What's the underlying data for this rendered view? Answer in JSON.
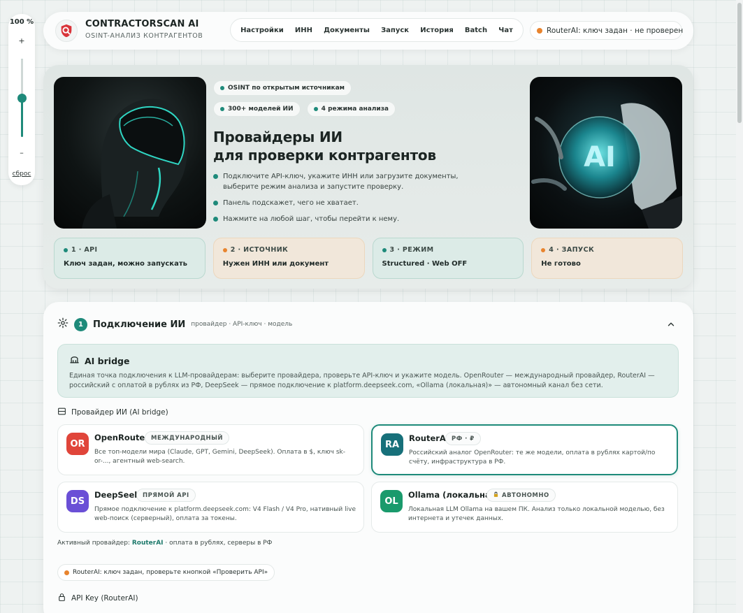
{
  "zoom": {
    "level": "100 %",
    "plus": "+",
    "minus": "–",
    "reset": "сброс",
    "slider_fraction": 0.5
  },
  "header": {
    "brand_title": "CONTRACTORSCAN AI",
    "brand_sub": "OSINT-АНАЛИЗ КОНТРАГЕНТОВ",
    "nav": [
      "Настройки",
      "ИНН",
      "Документы",
      "Запуск",
      "История",
      "Batch",
      "Чат"
    ],
    "status": "RouterAI: ключ задан · не проверен"
  },
  "hero": {
    "tags": [
      "OSINT по открытым источникам",
      "300+ моделей ИИ",
      "4 режима анализа"
    ],
    "title_line1": "Провайдеры ИИ",
    "title_line2": "для проверки контрагентов",
    "bullets": [
      "Подключите API-ключ, укажите ИНН или загрузите документы, выберите режим анализа и запустите проверку.",
      "Панель подскажет, чего не хватает.",
      "Нажмите на любой шаг, чтобы перейти к нему."
    ],
    "steps": [
      {
        "head": "1 · API",
        "value": "Ключ задан, можно запускать",
        "state": "ok"
      },
      {
        "head": "2 · ИСТОЧНИК",
        "value": "Нужен ИНН или документ",
        "state": "warn"
      },
      {
        "head": "3 · РЕЖИМ",
        "value": "Structured · Web OFF",
        "state": "ok"
      },
      {
        "head": "4 · ЗАПУСК",
        "value": "Не готово",
        "state": "warn"
      }
    ],
    "right_image_text": "AI"
  },
  "section": {
    "num": "1",
    "title": "Подключение ИИ",
    "sub": "провайдер · API-ключ · модель",
    "bridge_title": "AI bridge",
    "bridge_desc": "Единая точка подключения к LLM-провайдерам: выберите провайдера, проверьте API-ключ и укажите модель. OpenRouter — международный провайдер, RouterAI — российский с оплатой в рублях из РФ, DeepSeek — прямое подключение к platform.deepseek.com, «Ollama (локальная)» — автономный канал без сети.",
    "providers_head": "Провайдер ИИ (AI bridge)",
    "providers": [
      {
        "badge": "OR",
        "name": "OpenRouter",
        "chip": "МЕЖДУНАРОДНЫЙ",
        "desc": "Все топ-модели мира (Claude, GPT, Gemini, DeepSeek). Оплата в $, ключ sk-or-..., агентный web-search."
      },
      {
        "badge": "RA",
        "name": "RouterAI",
        "chip": "РФ · ₽",
        "desc": "Российский аналог OpenRouter: те же модели, оплата в рублях картой/по счёту, инфраструктура в РФ."
      },
      {
        "badge": "DS",
        "name": "DeepSeek",
        "chip": "ПРЯМОЙ API",
        "desc": "Прямое подключение к platform.deepseek.com: V4 Flash / V4 Pro, нативный live web-поиск (серверный), оплата за токены."
      },
      {
        "badge": "OL",
        "name": "Ollama (локальная)",
        "chip": "АВТОНОМНО",
        "desc": "Локальная LLM Ollama на вашем ПК. Анализ только локальной моделью, без интернета и утечек данных."
      }
    ],
    "active_prefix": "Активный провайдер: ",
    "active_name": "RouterAI",
    "active_suffix": " · оплата в рублях, серверы в РФ",
    "key_status": "RouterAI: ключ задан, проверьте кнопкой «Проверить API»",
    "api_key_head": "API Key (RouterAI)"
  },
  "colors": {
    "accent": "#1e8a7a",
    "warn": "#e8842e",
    "or_badge": "#e0453a",
    "ra_badge": "#17707a",
    "ds_badge": "#6a4fd6",
    "ol_badge": "#1a9a6c"
  }
}
